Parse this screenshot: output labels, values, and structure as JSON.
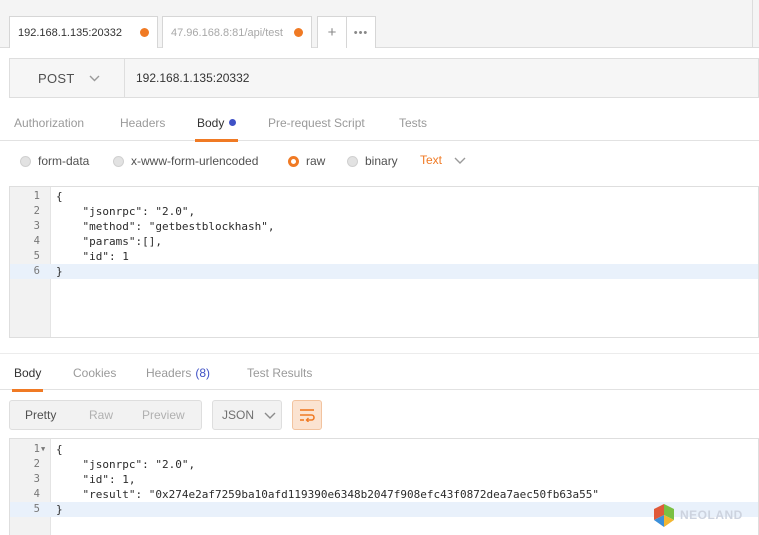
{
  "tabs": [
    {
      "label": "192.168.1.135:20332",
      "modified": true
    },
    {
      "label": "47.96.168.8:81/api/test",
      "modified": true
    }
  ],
  "tab_actions": {
    "new_tab": "+",
    "more": "•••"
  },
  "request": {
    "method": "POST",
    "url": "192.168.1.135:20332"
  },
  "request_tabs": [
    "Authorization",
    "Headers",
    "Body",
    "Pre-request Script",
    "Tests"
  ],
  "active_request_tab": "Body",
  "body_types": [
    "form-data",
    "x-www-form-urlencoded",
    "raw",
    "binary"
  ],
  "selected_body_type": "raw",
  "raw_format": "Text",
  "request_body_lines": [
    "{",
    "    \"jsonrpc\": \"2.0\",",
    "    \"method\": \"getbestblockhash\",",
    "    \"params\":[],",
    "    \"id\": 1",
    "}"
  ],
  "response_tabs": {
    "body": "Body",
    "cookies": "Cookies",
    "headers": "Headers",
    "headers_count": "(8)",
    "test_results": "Test Results"
  },
  "response_view_modes": [
    "Pretty",
    "Raw",
    "Preview"
  ],
  "active_view_mode": "Pretty",
  "response_format": "JSON",
  "response_body_lines": [
    "{",
    "    \"jsonrpc\": \"2.0\",",
    "    \"id\": 1,",
    "    \"result\": \"0x274e2af7259ba10afd119390e6348b2047f908efc43f0872dea7aec50fb63a55\"",
    "}"
  ],
  "watermark": "NEOLAND",
  "colors": {
    "accent": "#f07a24",
    "body_dot": "#3f51c6",
    "line_highlight": "#e9f1fb"
  }
}
